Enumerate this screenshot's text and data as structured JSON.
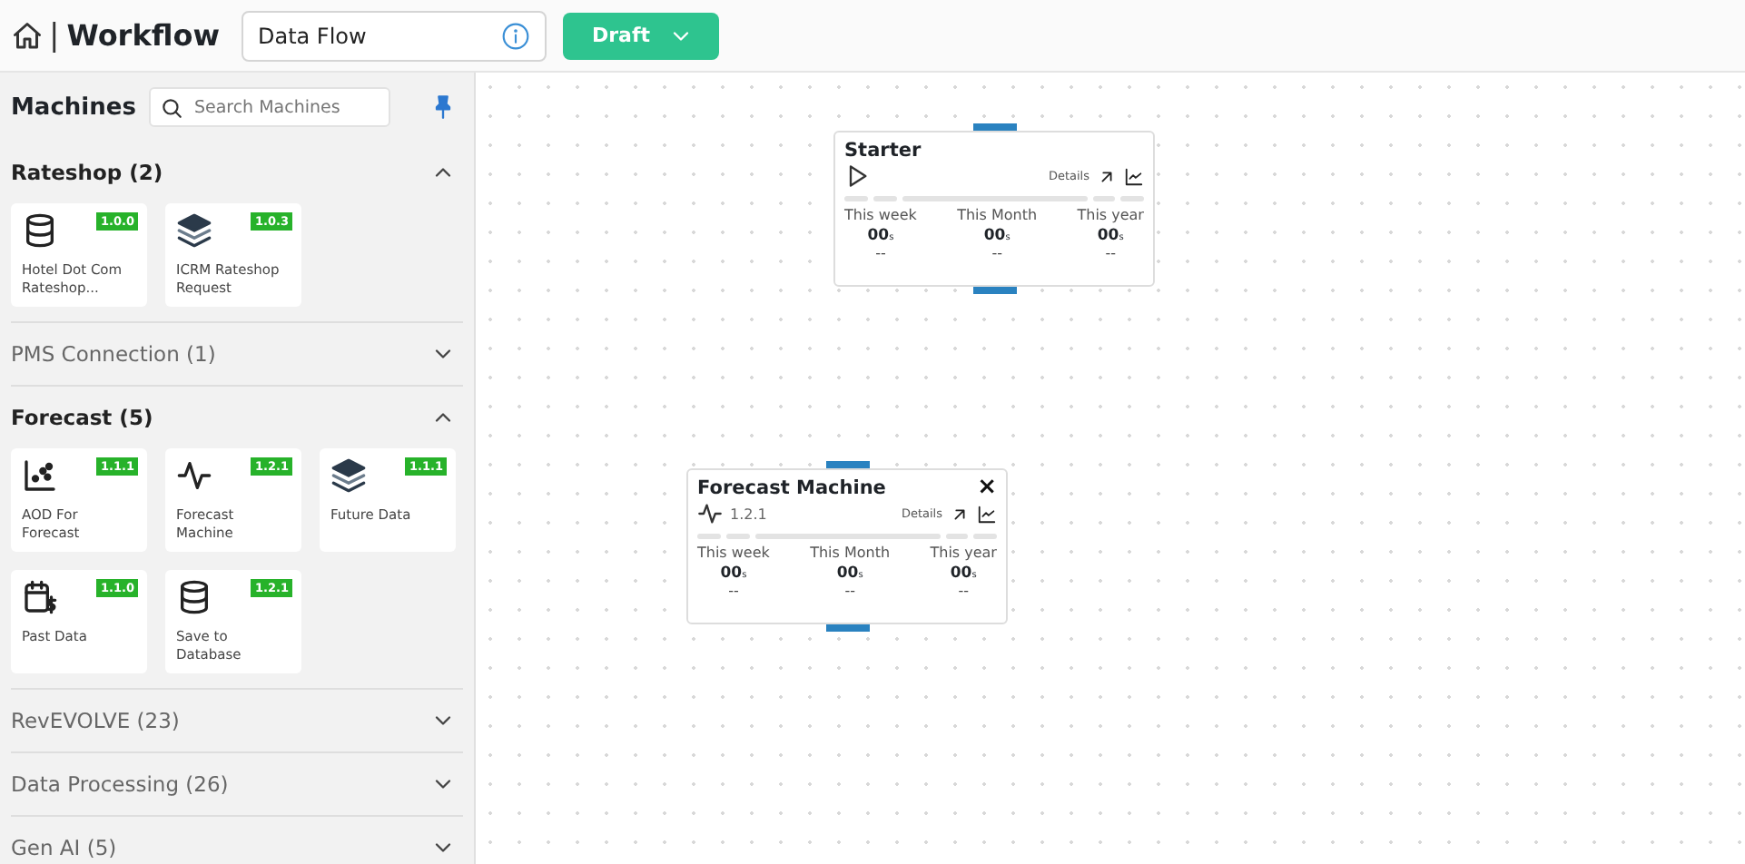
{
  "header": {
    "separator": "|",
    "title": "Workflow",
    "name_field": {
      "value": "Data Flow"
    },
    "status_button": "Draft"
  },
  "sidebar": {
    "title": "Machines",
    "search": {
      "placeholder": "Search Machines"
    },
    "pinned": true,
    "sections": [
      {
        "title": "Rateshop (2)",
        "expanded": true,
        "items": [
          {
            "kind": "database",
            "version": "1.0.0",
            "label": "Hotel Dot Com Rateshop..."
          },
          {
            "kind": "layers",
            "version": "1.0.3",
            "label": "ICRM Rateshop Request"
          }
        ]
      },
      {
        "title": "PMS Connection (1)",
        "expanded": false
      },
      {
        "title": "Forecast (5)",
        "expanded": true,
        "items": [
          {
            "kind": "scatter",
            "version": "1.1.1",
            "label": "AOD For Forecast"
          },
          {
            "kind": "pulse",
            "version": "1.2.1",
            "label": "Forecast Machine"
          },
          {
            "kind": "layers",
            "version": "1.1.1",
            "label": "Future Data"
          },
          {
            "kind": "calendar",
            "version": "1.1.0",
            "label": "Past Data"
          },
          {
            "kind": "database",
            "version": "1.2.1",
            "label": "Save to Database"
          }
        ]
      },
      {
        "title": "RevEVOLVE (23)",
        "expanded": false
      },
      {
        "title": "Data Processing (26)",
        "expanded": false
      },
      {
        "title": "Gen AI (5)",
        "expanded": false
      }
    ]
  },
  "canvas": {
    "nodes": [
      {
        "kind": "starter",
        "title": "Starter",
        "details": "Details",
        "stats": [
          {
            "label": "This week",
            "value": "00",
            "unit": "s",
            "sub": "--"
          },
          {
            "label": "This Month",
            "value": "00",
            "unit": "s",
            "sub": "--"
          },
          {
            "label": "This year",
            "value": "00",
            "unit": "s",
            "sub": "--"
          }
        ]
      },
      {
        "kind": "machine",
        "title": "Forecast Machine",
        "version": "1.2.1",
        "close": "×",
        "details": "Details",
        "stats": [
          {
            "label": "This week",
            "value": "00",
            "unit": "s",
            "sub": "--"
          },
          {
            "label": "This Month",
            "value": "00",
            "unit": "s",
            "sub": "--"
          },
          {
            "label": "This year",
            "value": "00",
            "unit": "s",
            "sub": "--"
          }
        ]
      }
    ]
  }
}
